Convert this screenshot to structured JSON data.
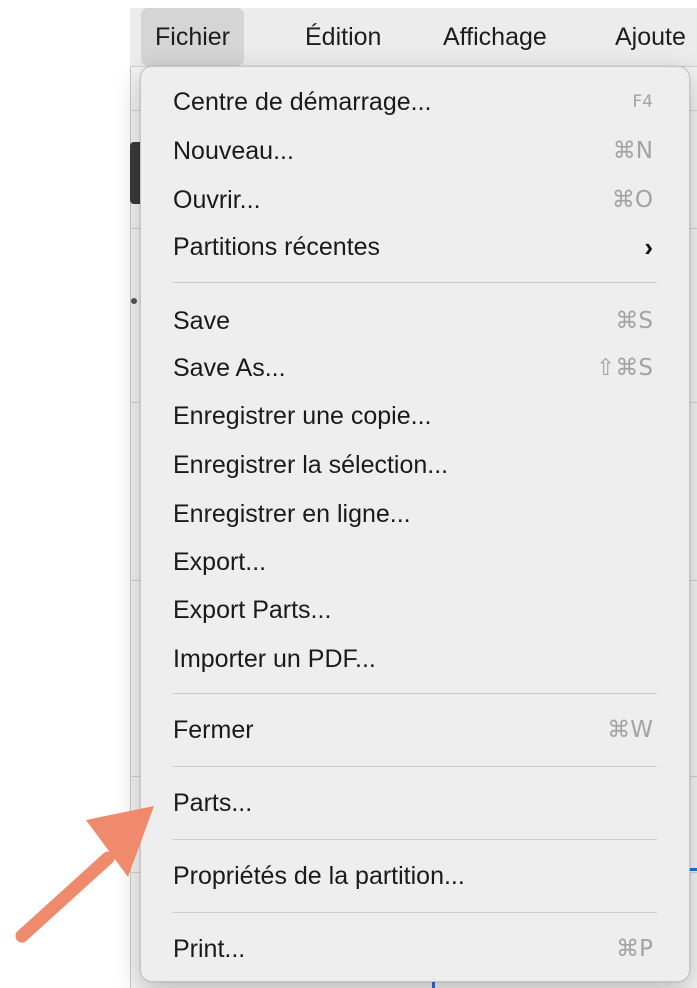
{
  "menubar": {
    "items": [
      {
        "label": "Fichier",
        "active": true
      },
      {
        "label": "Édition",
        "active": false
      },
      {
        "label": "Affichage",
        "active": false
      },
      {
        "label": "Ajoute",
        "active": false
      }
    ]
  },
  "menu": {
    "items": [
      {
        "label": "Centre de démarrage...",
        "shortcut": "F4"
      },
      {
        "label": "Nouveau...",
        "shortcut": "⌘N"
      },
      {
        "label": "Ouvrir...",
        "shortcut": "⌘O"
      },
      {
        "label": "Partitions récentes",
        "submenu_indicator": "›"
      },
      {
        "label": "Save",
        "shortcut": "⌘S"
      },
      {
        "label": "Save As...",
        "shortcut": "⇧⌘S"
      },
      {
        "label": "Enregistrer une copie...",
        "shortcut": ""
      },
      {
        "label": "Enregistrer la sélection...",
        "shortcut": ""
      },
      {
        "label": "Enregistrer en ligne...",
        "shortcut": ""
      },
      {
        "label": "Export...",
        "shortcut": ""
      },
      {
        "label": "Export Parts...",
        "shortcut": ""
      },
      {
        "label": "Importer un PDF...",
        "shortcut": ""
      },
      {
        "label": "Fermer",
        "shortcut": "⌘W"
      },
      {
        "label": "Parts...",
        "shortcut": ""
      },
      {
        "label": "Propriétés de la partition...",
        "shortcut": ""
      },
      {
        "label": "Print...",
        "shortcut": "⌘P"
      }
    ]
  },
  "annotation": {
    "icon": "arrow-icon",
    "color": "#f08a6c",
    "points_to": "Parts..."
  }
}
